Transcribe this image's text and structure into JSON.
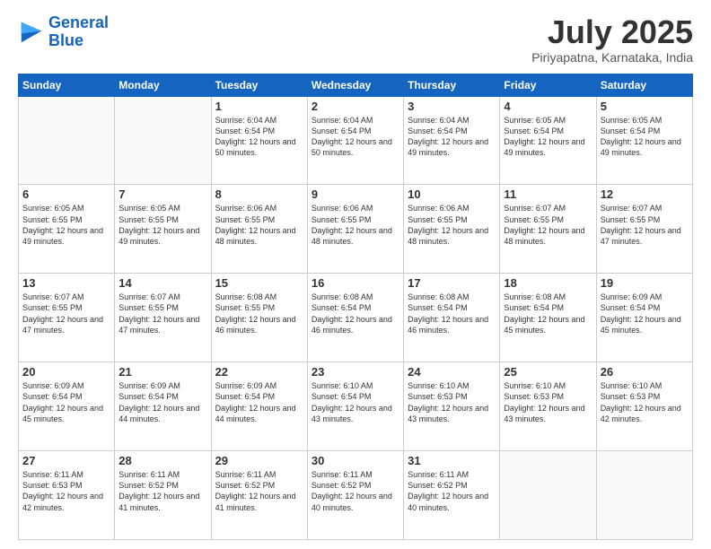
{
  "header": {
    "logo_line1": "General",
    "logo_line2": "Blue",
    "month": "July 2025",
    "location": "Piriyapatna, Karnataka, India"
  },
  "weekdays": [
    "Sunday",
    "Monday",
    "Tuesday",
    "Wednesday",
    "Thursday",
    "Friday",
    "Saturday"
  ],
  "weeks": [
    [
      {
        "day": "",
        "info": ""
      },
      {
        "day": "",
        "info": ""
      },
      {
        "day": "1",
        "info": "Sunrise: 6:04 AM\nSunset: 6:54 PM\nDaylight: 12 hours\nand 50 minutes."
      },
      {
        "day": "2",
        "info": "Sunrise: 6:04 AM\nSunset: 6:54 PM\nDaylight: 12 hours\nand 50 minutes."
      },
      {
        "day": "3",
        "info": "Sunrise: 6:04 AM\nSunset: 6:54 PM\nDaylight: 12 hours\nand 49 minutes."
      },
      {
        "day": "4",
        "info": "Sunrise: 6:05 AM\nSunset: 6:54 PM\nDaylight: 12 hours\nand 49 minutes."
      },
      {
        "day": "5",
        "info": "Sunrise: 6:05 AM\nSunset: 6:54 PM\nDaylight: 12 hours\nand 49 minutes."
      }
    ],
    [
      {
        "day": "6",
        "info": "Sunrise: 6:05 AM\nSunset: 6:55 PM\nDaylight: 12 hours\nand 49 minutes."
      },
      {
        "day": "7",
        "info": "Sunrise: 6:05 AM\nSunset: 6:55 PM\nDaylight: 12 hours\nand 49 minutes."
      },
      {
        "day": "8",
        "info": "Sunrise: 6:06 AM\nSunset: 6:55 PM\nDaylight: 12 hours\nand 48 minutes."
      },
      {
        "day": "9",
        "info": "Sunrise: 6:06 AM\nSunset: 6:55 PM\nDaylight: 12 hours\nand 48 minutes."
      },
      {
        "day": "10",
        "info": "Sunrise: 6:06 AM\nSunset: 6:55 PM\nDaylight: 12 hours\nand 48 minutes."
      },
      {
        "day": "11",
        "info": "Sunrise: 6:07 AM\nSunset: 6:55 PM\nDaylight: 12 hours\nand 48 minutes."
      },
      {
        "day": "12",
        "info": "Sunrise: 6:07 AM\nSunset: 6:55 PM\nDaylight: 12 hours\nand 47 minutes."
      }
    ],
    [
      {
        "day": "13",
        "info": "Sunrise: 6:07 AM\nSunset: 6:55 PM\nDaylight: 12 hours\nand 47 minutes."
      },
      {
        "day": "14",
        "info": "Sunrise: 6:07 AM\nSunset: 6:55 PM\nDaylight: 12 hours\nand 47 minutes."
      },
      {
        "day": "15",
        "info": "Sunrise: 6:08 AM\nSunset: 6:55 PM\nDaylight: 12 hours\nand 46 minutes."
      },
      {
        "day": "16",
        "info": "Sunrise: 6:08 AM\nSunset: 6:54 PM\nDaylight: 12 hours\nand 46 minutes."
      },
      {
        "day": "17",
        "info": "Sunrise: 6:08 AM\nSunset: 6:54 PM\nDaylight: 12 hours\nand 46 minutes."
      },
      {
        "day": "18",
        "info": "Sunrise: 6:08 AM\nSunset: 6:54 PM\nDaylight: 12 hours\nand 45 minutes."
      },
      {
        "day": "19",
        "info": "Sunrise: 6:09 AM\nSunset: 6:54 PM\nDaylight: 12 hours\nand 45 minutes."
      }
    ],
    [
      {
        "day": "20",
        "info": "Sunrise: 6:09 AM\nSunset: 6:54 PM\nDaylight: 12 hours\nand 45 minutes."
      },
      {
        "day": "21",
        "info": "Sunrise: 6:09 AM\nSunset: 6:54 PM\nDaylight: 12 hours\nand 44 minutes."
      },
      {
        "day": "22",
        "info": "Sunrise: 6:09 AM\nSunset: 6:54 PM\nDaylight: 12 hours\nand 44 minutes."
      },
      {
        "day": "23",
        "info": "Sunrise: 6:10 AM\nSunset: 6:54 PM\nDaylight: 12 hours\nand 43 minutes."
      },
      {
        "day": "24",
        "info": "Sunrise: 6:10 AM\nSunset: 6:53 PM\nDaylight: 12 hours\nand 43 minutes."
      },
      {
        "day": "25",
        "info": "Sunrise: 6:10 AM\nSunset: 6:53 PM\nDaylight: 12 hours\nand 43 minutes."
      },
      {
        "day": "26",
        "info": "Sunrise: 6:10 AM\nSunset: 6:53 PM\nDaylight: 12 hours\nand 42 minutes."
      }
    ],
    [
      {
        "day": "27",
        "info": "Sunrise: 6:11 AM\nSunset: 6:53 PM\nDaylight: 12 hours\nand 42 minutes."
      },
      {
        "day": "28",
        "info": "Sunrise: 6:11 AM\nSunset: 6:52 PM\nDaylight: 12 hours\nand 41 minutes."
      },
      {
        "day": "29",
        "info": "Sunrise: 6:11 AM\nSunset: 6:52 PM\nDaylight: 12 hours\nand 41 minutes."
      },
      {
        "day": "30",
        "info": "Sunrise: 6:11 AM\nSunset: 6:52 PM\nDaylight: 12 hours\nand 40 minutes."
      },
      {
        "day": "31",
        "info": "Sunrise: 6:11 AM\nSunset: 6:52 PM\nDaylight: 12 hours\nand 40 minutes."
      },
      {
        "day": "",
        "info": ""
      },
      {
        "day": "",
        "info": ""
      }
    ]
  ]
}
